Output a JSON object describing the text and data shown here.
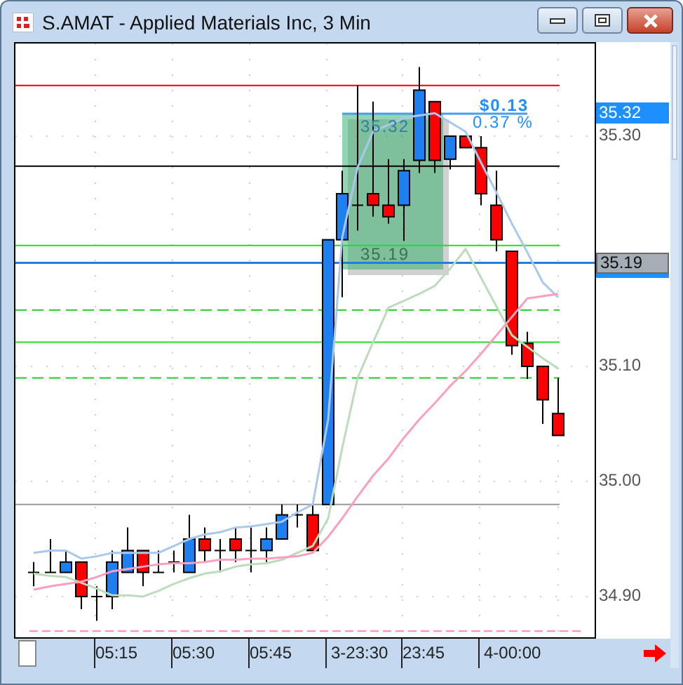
{
  "window": {
    "title": "S.AMAT - Applied Materials Inc, 3 Min"
  },
  "measurement": {
    "change": "$0.13",
    "percent": "0.37 %",
    "top_price": "35.32",
    "bottom_price": "35.19"
  },
  "chart": {
    "chart_data": {
      "type": "candlestick",
      "grid": true,
      "ylim": [
        34.8622,
        35.3805
      ],
      "ohlc": [
        [
          34.921,
          34.93,
          34.909,
          34.921
        ],
        [
          34.921,
          34.95,
          34.921,
          34.921
        ],
        [
          34.921,
          34.94,
          34.921,
          34.93
        ],
        [
          34.93,
          34.93,
          34.889,
          34.9
        ],
        [
          34.9,
          34.909,
          34.879,
          34.9
        ],
        [
          34.9,
          34.94,
          34.889,
          34.93
        ],
        [
          34.921,
          34.96,
          34.921,
          34.94
        ],
        [
          34.94,
          34.94,
          34.909,
          34.921
        ],
        [
          34.921,
          34.94,
          34.921,
          34.921
        ],
        [
          34.93,
          34.94,
          34.921,
          34.93
        ],
        [
          34.921,
          34.971,
          34.921,
          34.95
        ],
        [
          34.95,
          34.96,
          34.93,
          34.94
        ],
        [
          34.94,
          34.95,
          34.921,
          34.94
        ],
        [
          34.95,
          34.96,
          34.93,
          34.94
        ],
        [
          34.94,
          34.96,
          34.921,
          34.94
        ],
        [
          34.94,
          34.96,
          34.93,
          34.95
        ],
        [
          34.95,
          34.98,
          34.95,
          34.971
        ],
        [
          34.971,
          34.98,
          34.96,
          34.971
        ],
        [
          34.971,
          34.98,
          34.94,
          34.94
        ],
        [
          34.98,
          35.21,
          34.98,
          35.21
        ],
        [
          35.21,
          35.27,
          35.16,
          35.25
        ],
        [
          35.24,
          35.344,
          35.218,
          35.24
        ],
        [
          35.25,
          35.33,
          35.23,
          35.24
        ],
        [
          35.24,
          35.28,
          35.224,
          35.23
        ],
        [
          35.24,
          35.28,
          35.209,
          35.27
        ],
        [
          35.279,
          35.36,
          35.268,
          35.34
        ],
        [
          35.33,
          35.33,
          35.268,
          35.279
        ],
        [
          35.28,
          35.3,
          35.271,
          35.3
        ],
        [
          35.3,
          35.3,
          35.29,
          35.29
        ],
        [
          35.29,
          35.3,
          35.24,
          35.25
        ],
        [
          35.24,
          35.27,
          35.2,
          35.21
        ],
        [
          35.2,
          35.2,
          35.11,
          35.118
        ],
        [
          35.12,
          35.13,
          35.089,
          35.1
        ],
        [
          35.1,
          35.1,
          35.05,
          35.071
        ],
        [
          35.059,
          35.09,
          35.04,
          35.04
        ]
      ],
      "series": [
        {
          "type": "line",
          "color": "#a9c8ee",
          "values": [
            34.938,
            34.94,
            34.94,
            34.933,
            34.935,
            34.938,
            34.938,
            34.938,
            34.938,
            34.944,
            34.95,
            34.954,
            34.956,
            34.96,
            34.961,
            34.963,
            34.965,
            34.973,
            34.98,
            35.054,
            35.212,
            35.273,
            35.304,
            35.31,
            35.316,
            35.318,
            35.32,
            35.312,
            35.304,
            35.277,
            35.251,
            35.224,
            35.199,
            35.173,
            35.16
          ]
        },
        {
          "type": "line",
          "color": "#bcdcbc",
          "values": [
            34.92,
            34.918,
            34.917,
            34.912,
            34.907,
            34.901,
            34.901,
            34.9,
            34.905,
            34.911,
            34.916,
            34.92,
            34.922,
            34.926,
            34.928,
            34.929,
            34.932,
            34.938,
            34.944,
            34.968,
            35.029,
            35.09,
            35.121,
            35.151,
            35.157,
            35.163,
            35.17,
            35.185,
            35.202,
            35.177,
            35.152,
            35.127,
            35.117,
            35.107,
            35.098
          ]
        },
        {
          "type": "line",
          "color": "#f9a0c0",
          "values": [
            34.906,
            34.909,
            34.911,
            34.913,
            34.917,
            34.922,
            34.924,
            34.926,
            34.928,
            34.929,
            34.929,
            34.93,
            34.932,
            34.932,
            34.933,
            34.933,
            34.934,
            34.935,
            34.938,
            34.952,
            34.968,
            34.987,
            35.005,
            35.02,
            35.038,
            35.054,
            35.068,
            35.083,
            35.096,
            35.111,
            35.127,
            35.143,
            35.159,
            35.161,
            35.163
          ]
        }
      ],
      "ref_lines": [
        {
          "axis": "y",
          "value": 35.344,
          "color": "#ee0000"
        },
        {
          "axis": "y",
          "value": 35.274,
          "color": "#000000"
        },
        {
          "axis": "y",
          "value": 35.205,
          "color": "#22dd22"
        },
        {
          "axis": "y",
          "value": 35.19,
          "color": "#1e7fe6"
        },
        {
          "axis": "y",
          "value": 35.149,
          "color": "#22cc22"
        },
        {
          "axis": "y",
          "value": 35.121,
          "color": "#22dd22"
        },
        {
          "axis": "y",
          "value": 35.09,
          "color": "#22cc22"
        },
        {
          "axis": "y",
          "value": 34.98,
          "color": "#999999"
        },
        {
          "axis": "y",
          "value": 34.87,
          "color": "#ff88aa"
        }
      ],
      "yticks": [
        {
          "value": 35.3,
          "label": "35.30"
        },
        {
          "value": 35.1,
          "label": "35.10"
        },
        {
          "value": 35.0,
          "label": "35.00"
        },
        {
          "value": 34.9,
          "label": "34.90"
        }
      ]
    }
  },
  "time_axis": [
    "05:15",
    "05:30",
    "05:45",
    "3-23:30",
    "23:45",
    "4-00:00"
  ],
  "price_markers": [
    {
      "text": "35.32",
      "kind": "marker"
    },
    {
      "text": "35.19",
      "kind": "last"
    }
  ]
}
